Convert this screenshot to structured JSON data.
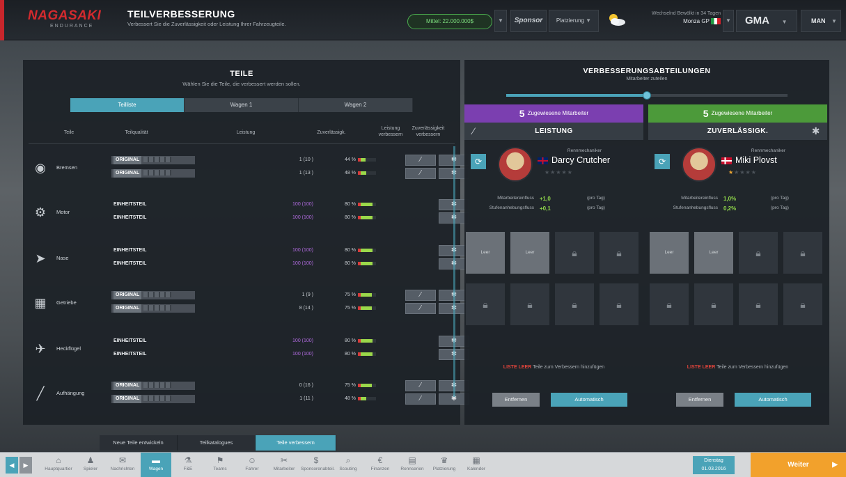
{
  "header": {
    "logo_text": "NAGASAKI",
    "logo_sub": "ENDURANCE",
    "title": "TEILVERBESSERUNG",
    "subtitle": "Verbessert Sie die Zuverlässigkeit oder Leistung Ihrer Fahrzeugteile.",
    "funds": "Mittel: 22.000.000$",
    "sponsor_label": "Sponsor",
    "standings_label": "Platzierung",
    "weather_line": "Wechselnd Bewölkt in 34 Tagen",
    "race_label": "Monza GP",
    "gma_label": "GMA",
    "profile_label": "MAN"
  },
  "left_panel": {
    "title": "TEILE",
    "subtitle": "Wählen Sie die Teile, die verbessert werden sollen.",
    "tabs": [
      "Teilliste",
      "Wagen 1",
      "Wagen 2"
    ],
    "columns": {
      "part": "Teile",
      "quality": "Teilqualität",
      "performance": "Leistung",
      "reliability": "Zuverlässigk.",
      "improve_perf": "Leistung verbessern",
      "improve_rel": "Zuverlässigkeit verbessern"
    },
    "parts": [
      {
        "name": "Bremsen",
        "icon": "brakes-icon",
        "rows": [
          {
            "quality": "ORIGINAL",
            "perf": "1 (10 )",
            "perf_purple": false,
            "rel": "44 %",
            "rel_fill": 0.44,
            "perf_btn": true
          },
          {
            "quality": "ORIGINAL",
            "perf": "1 (13 )",
            "perf_purple": false,
            "rel": "48 %",
            "rel_fill": 0.48,
            "perf_btn": true
          }
        ]
      },
      {
        "name": "Motor",
        "icon": "engine-icon",
        "rows": [
          {
            "quality": "EINHEITSTEIL",
            "perf": "100 (100)",
            "perf_purple": true,
            "rel": "80 %",
            "rel_fill": 0.8,
            "perf_btn": false
          },
          {
            "quality": "EINHEITSTEIL",
            "perf": "100 (100)",
            "perf_purple": true,
            "rel": "80 %",
            "rel_fill": 0.8,
            "perf_btn": false
          }
        ]
      },
      {
        "name": "Nase",
        "icon": "nose-icon",
        "rows": [
          {
            "quality": "EINHEITSTEIL",
            "perf": "100 (100)",
            "perf_purple": true,
            "rel": "80 %",
            "rel_fill": 0.8,
            "perf_btn": false
          },
          {
            "quality": "EINHEITSTEIL",
            "perf": "100 (100)",
            "perf_purple": true,
            "rel": "80 %",
            "rel_fill": 0.8,
            "perf_btn": false
          }
        ]
      },
      {
        "name": "Getriebe",
        "icon": "gearbox-icon",
        "rows": [
          {
            "quality": "ORIGINAL",
            "perf": "1 (9 )",
            "perf_purple": false,
            "rel": "75 %",
            "rel_fill": 0.75,
            "perf_btn": true
          },
          {
            "quality": "ORIGINAL",
            "perf": "8 (14 )",
            "perf_purple": false,
            "rel": "75 %",
            "rel_fill": 0.75,
            "perf_btn": true
          }
        ]
      },
      {
        "name": "Heckflügel",
        "icon": "rear-wing-icon",
        "rows": [
          {
            "quality": "EINHEITSTEIL",
            "perf": "100 (100)",
            "perf_purple": true,
            "rel": "80 %",
            "rel_fill": 0.8,
            "perf_btn": false
          },
          {
            "quality": "EINHEITSTEIL",
            "perf": "100 (100)",
            "perf_purple": true,
            "rel": "80 %",
            "rel_fill": 0.8,
            "perf_btn": false
          }
        ]
      },
      {
        "name": "Aufhängung",
        "icon": "suspension-icon",
        "rows": [
          {
            "quality": "ORIGINAL",
            "perf": "0 (16 )",
            "perf_purple": false,
            "rel": "75 %",
            "rel_fill": 0.75,
            "perf_btn": true
          },
          {
            "quality": "ORIGINAL",
            "perf": "1 (11 )",
            "perf_purple": false,
            "rel": "48 %",
            "rel_fill": 0.48,
            "perf_btn": true
          }
        ]
      }
    ]
  },
  "right_panel": {
    "title": "VERBESSERUNGSABTEILUNGEN",
    "subtitle": "Mitarbeiter zuteilen",
    "slider_value": 0.5,
    "departments": [
      {
        "count": "5",
        "count_label": "Zugewiesene Mitarbeiter",
        "title": "LEISTUNG",
        "color": "#7b3fb0",
        "role": "Rennmechaniker",
        "mechanic": "Darcy Crutcher",
        "flag": "uk",
        "stars": 0,
        "stat1_label": "Mitarbeitereinfluss",
        "stat1_value": "+1,0",
        "stat2_label": "Stufenanhebungsfluss",
        "stat2_value": "+0,1",
        "unit": "(pro Tag)",
        "slots_empty": [
          "Leer",
          "Leer"
        ],
        "empty_list_red": "LISTE LEER",
        "empty_list_text": "Teile zum Verbessern hinzufügen",
        "cancel_label": "Entfernen",
        "auto_label": "Automatisch"
      },
      {
        "count": "5",
        "count_label": "Zugewiesene Mitarbeiter",
        "title": "ZUVERLÄSSIGK.",
        "color": "#4c9a3a",
        "role": "Rennmechaniker",
        "mechanic": "Miki Plovst",
        "flag": "dk",
        "stars": 1,
        "stat1_label": "Mitarbeitereinfluss",
        "stat1_value": "1,0%",
        "stat2_label": "Stufenanhebungsfluss",
        "stat2_value": "0,2%",
        "unit": "(pro Tag)",
        "slots_empty": [
          "Leer",
          "Leer"
        ],
        "empty_list_red": "LISTE LEER",
        "empty_list_text": "Teile zum Verbessern hinzufügen",
        "cancel_label": "Entfernen",
        "auto_label": "Automatisch"
      }
    ]
  },
  "subtabs": [
    "Neue Teile entwickeln",
    "Teilkatalogues",
    "Teile verbessern"
  ],
  "bottom_nav": [
    {
      "label": "Hauptquartier",
      "icon": "home-icon"
    },
    {
      "label": "Spieler",
      "icon": "player-icon"
    },
    {
      "label": "Nachrichten",
      "icon": "mail-icon"
    },
    {
      "label": "Wagen",
      "icon": "car-icon",
      "active": true
    },
    {
      "label": "F&E",
      "icon": "research-icon"
    },
    {
      "label": "Teams",
      "icon": "team-icon"
    },
    {
      "label": "Fahrer",
      "icon": "driver-icon"
    },
    {
      "label": "Mitarbeiter",
      "icon": "staff-icon"
    },
    {
      "label": "Sponsorenabteil.",
      "icon": "sponsor-icon"
    },
    {
      "label": "Scouting",
      "icon": "scout-icon"
    },
    {
      "label": "Finanzen",
      "icon": "finance-icon"
    },
    {
      "label": "Rennserien",
      "icon": "series-icon"
    },
    {
      "label": "Platzierung",
      "icon": "trophy-icon"
    },
    {
      "label": "Kalender",
      "icon": "calendar-icon"
    }
  ],
  "date": {
    "day": "Dienstag",
    "value": "01.03.2016"
  },
  "continue_label": "Weiter"
}
